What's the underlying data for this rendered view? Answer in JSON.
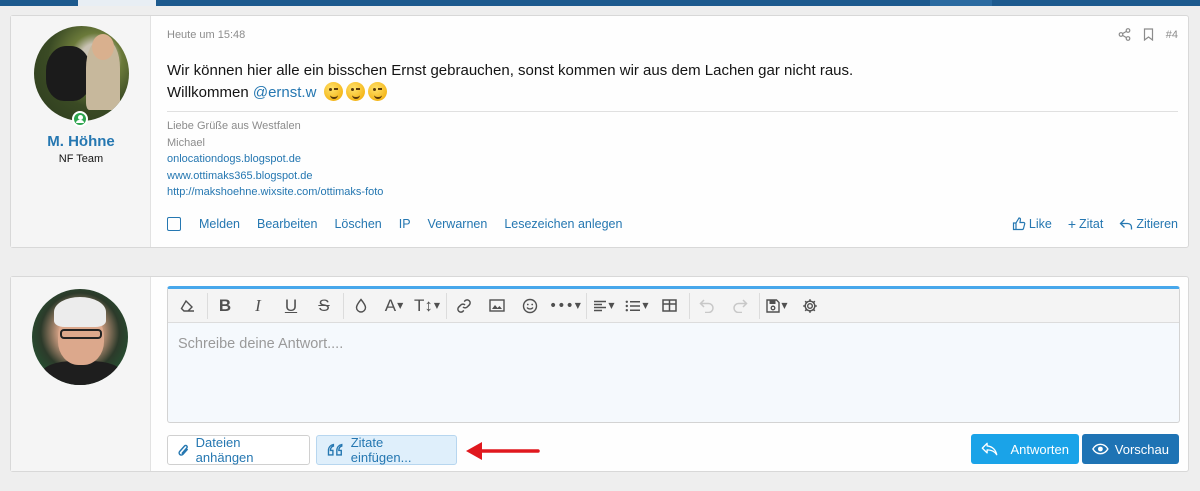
{
  "post": {
    "author_name": "M. Höhne",
    "author_title": "NF Team",
    "date": "Heute um 15:48",
    "post_number": "#4",
    "message_line1": "Wir können hier alle ein bisschen Ernst gebrauchen, sonst kommen wir aus dem Lachen gar nicht raus.",
    "message_line2_prefix": "Willkommen",
    "mention": "@ernst.w",
    "emoji_count": 3,
    "signature": {
      "line1": "Liebe Grüße aus Westfalen",
      "line2": "Michael",
      "links": [
        "onlocationdogs.blogspot.de",
        "www.ottimaks365.blogspot.de",
        "http://makshoehne.wixsite.com/ottimaks-foto"
      ]
    },
    "actions": [
      "Melden",
      "Bearbeiten",
      "Löschen",
      "IP",
      "Verwarnen",
      "Lesezeichen anlegen"
    ],
    "reactions": {
      "like": "Like",
      "add_quote": "Zitat",
      "quote": "Zitieren"
    }
  },
  "reply": {
    "placeholder": "Schreibe deine Antwort....",
    "attach_label": "Dateien anhängen",
    "insert_quotes_label": "Zitate einfügen...",
    "submit_label": "Antworten",
    "preview_label": "Vorschau"
  },
  "colors": {
    "accent": "#2577b1",
    "editor_top": "#47a7eb",
    "reply_button": "#1aa3e8",
    "preview_button": "#1e73b4",
    "arrow": "#e0181e"
  }
}
